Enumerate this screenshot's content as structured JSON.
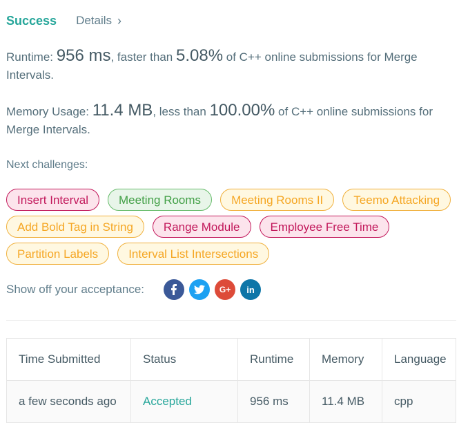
{
  "header": {
    "status": "Success",
    "details_label": "Details",
    "details_chevron": "›"
  },
  "runtime": {
    "label": "Runtime:",
    "value": "956 ms",
    "mid": ", faster than",
    "percent": "5.08%",
    "tail": "of C++ online submissions for Merge Intervals."
  },
  "memory": {
    "label": "Memory Usage:",
    "value": "11.4 MB",
    "mid": ", less than",
    "percent": "100.00%",
    "tail": "of C++ online submissions for Merge Intervals."
  },
  "next": {
    "title": "Next challenges:",
    "tags": [
      {
        "label": "Insert Interval",
        "difficulty": "hard"
      },
      {
        "label": "Meeting Rooms",
        "difficulty": "easy"
      },
      {
        "label": "Meeting Rooms II",
        "difficulty": "medium"
      },
      {
        "label": "Teemo Attacking",
        "difficulty": "medium"
      },
      {
        "label": "Add Bold Tag in String",
        "difficulty": "medium"
      },
      {
        "label": "Range Module",
        "difficulty": "hard"
      },
      {
        "label": "Employee Free Time",
        "difficulty": "hard"
      },
      {
        "label": "Partition Labels",
        "difficulty": "medium"
      },
      {
        "label": "Interval List Intersections",
        "difficulty": "medium"
      }
    ]
  },
  "share": {
    "label": "Show off your acceptance:",
    "icons": [
      {
        "name": "facebook-icon",
        "glyph": "f"
      },
      {
        "name": "twitter-icon",
        "glyph": "🐦"
      },
      {
        "name": "google-plus-icon",
        "glyph": "G+"
      },
      {
        "name": "linkedin-icon",
        "glyph": "in"
      }
    ]
  },
  "table": {
    "headers": [
      "Time Submitted",
      "Status",
      "Runtime",
      "Memory",
      "Language"
    ],
    "rows": [
      [
        "a few seconds ago",
        "Accepted",
        "956 ms",
        "11.4 MB",
        "cpp"
      ]
    ]
  },
  "colors": {
    "success": "#26a69a",
    "hard": "#c2185b",
    "easy": "#43a047",
    "medium": "#f5a623"
  }
}
